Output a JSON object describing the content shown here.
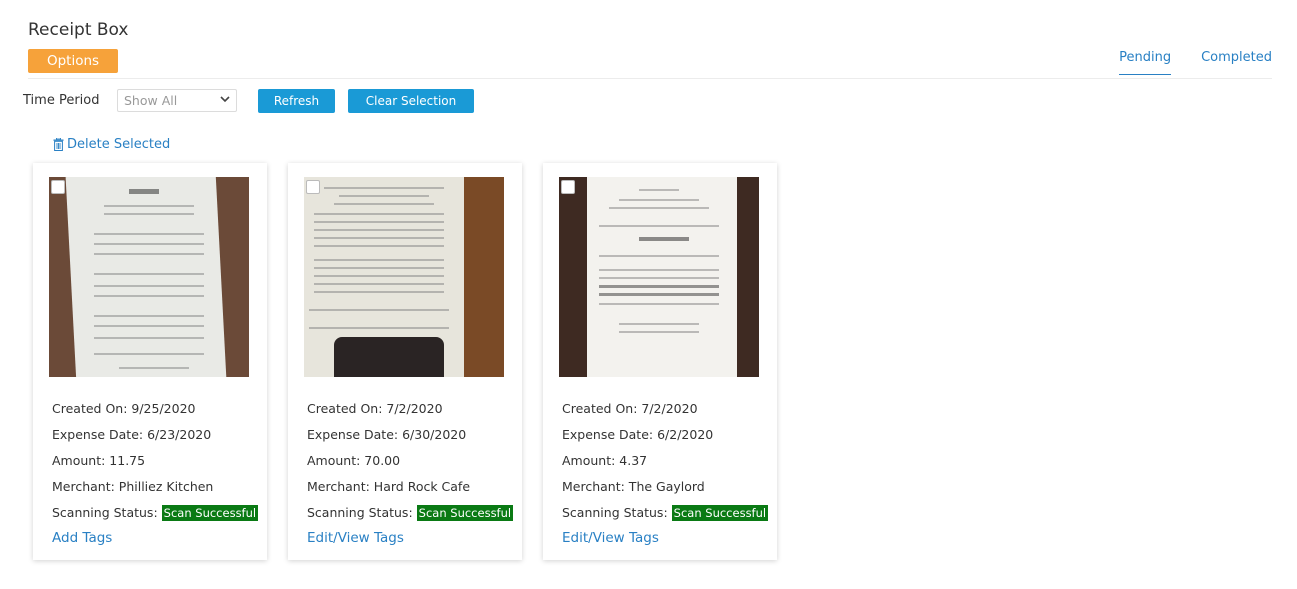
{
  "page": {
    "title": "Receipt Box",
    "options_label": "Options"
  },
  "tabs": [
    {
      "label": "Pending",
      "active": true
    },
    {
      "label": "Completed",
      "active": false
    }
  ],
  "filters": {
    "time_period_label": "Time Period",
    "time_period_value": "Show All",
    "refresh_label": "Refresh",
    "clear_selection_label": "Clear Selection"
  },
  "actions": {
    "delete_selected_label": "Delete Selected"
  },
  "colors": {
    "accent_blue": "#1a9ad6",
    "link_blue": "#2980c4",
    "options_orange": "#f6a23a",
    "status_green": "#0a7a14"
  },
  "receipts": [
    {
      "created_on": "Created On: 9/25/2020",
      "expense_date": "Expense Date: 6/23/2020",
      "amount": "Amount: 11.75",
      "merchant": "Merchant: Philliez Kitchen",
      "scanning_status_label": "Scanning Status:",
      "scanning_status": "Scan Successful",
      "tags_link": "Add Tags",
      "image_bg": "#6b4a38"
    },
    {
      "created_on": "Created On: 7/2/2020",
      "expense_date": "Expense Date:  6/30/2020",
      "amount": "Amount: 70.00",
      "merchant": "Merchant: Hard Rock Cafe",
      "scanning_status_label": "Scanning Status:",
      "scanning_status": "Scan Successful",
      "tags_link": "Edit/View Tags",
      "image_bg": "#7a4a26"
    },
    {
      "created_on": "Created On: 7/2/2020",
      "expense_date": "Expense Date: 6/2/2020",
      "amount": "Amount: 4.37",
      "merchant": "Merchant: The Gaylord",
      "scanning_status_label": "Scanning Status:",
      "scanning_status": "Scan Successful",
      "tags_link": "Edit/View Tags",
      "image_bg": "#3e2a22"
    }
  ]
}
